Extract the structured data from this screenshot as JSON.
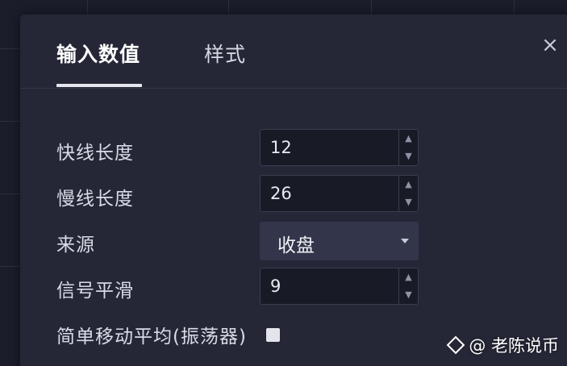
{
  "dialog": {
    "tabs": [
      {
        "label": "输入数值",
        "active": true
      },
      {
        "label": "样式",
        "active": false
      }
    ],
    "close_icon": "close-icon"
  },
  "inputs": {
    "fast_length": {
      "label": "快线长度",
      "value": "12"
    },
    "slow_length": {
      "label": "慢线长度",
      "value": "26"
    },
    "source": {
      "label": "来源",
      "value": "收盘"
    },
    "signal_smoothing": {
      "label": "信号平滑",
      "value": "9"
    },
    "sma_oscillator": {
      "label": "简单移动平均(振荡器)",
      "checked": false
    }
  },
  "watermark": {
    "text": "@ 老陈说币"
  },
  "colors": {
    "background": "#1b1d2b",
    "dialog": "#252737",
    "input": "#181a26",
    "select": "#33364a"
  }
}
